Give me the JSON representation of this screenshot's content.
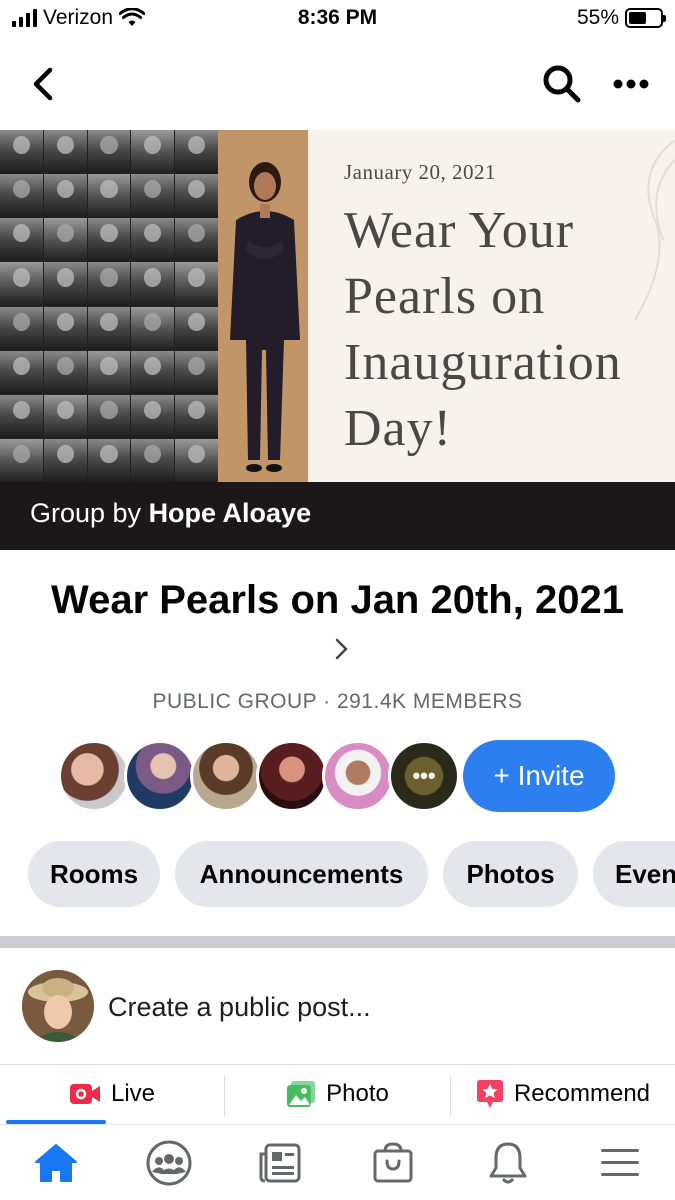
{
  "status_bar": {
    "carrier": "Verizon",
    "time": "8:36 PM",
    "battery_text": "55%",
    "battery_level": 0.55
  },
  "nav": {
    "back_icon": "chevron-left-icon",
    "search_icon": "search-icon",
    "more_icon": "more-horizontal-icon"
  },
  "cover": {
    "date": "January 20, 2021",
    "headline": "Wear Your\nPearls on\nInauguration\nDay!",
    "group_by_prefix": "Group by ",
    "group_by_name": "Hope Aloaye"
  },
  "group": {
    "title": "Wear Pearls on Jan 20th, 2021",
    "meta": "PUBLIC GROUP · 291.4K MEMBERS",
    "invite_label": "+ Invite",
    "more_members_glyph": "•••"
  },
  "chips": [
    "Rooms",
    "Announcements",
    "Photos",
    "Even"
  ],
  "composer": {
    "prompt": "Create a public post..."
  },
  "actions": [
    {
      "label": "Live",
      "icon": "live-video-icon",
      "color": "#f02849"
    },
    {
      "label": "Photo",
      "icon": "photo-icon",
      "color": "#45bd62"
    },
    {
      "label": "Recommend",
      "icon": "recommend-icon",
      "color": "#f3425f"
    }
  ],
  "tabbar": [
    "home-icon",
    "groups-icon",
    "news-icon",
    "marketplace-icon",
    "notifications-icon",
    "menu-icon"
  ],
  "colors": {
    "accent": "#1877f2",
    "invite_button": "#2d7ff0",
    "chip_bg": "#e4e6eb",
    "meta_text": "#65676b",
    "cover_footer": "#1c181a"
  }
}
